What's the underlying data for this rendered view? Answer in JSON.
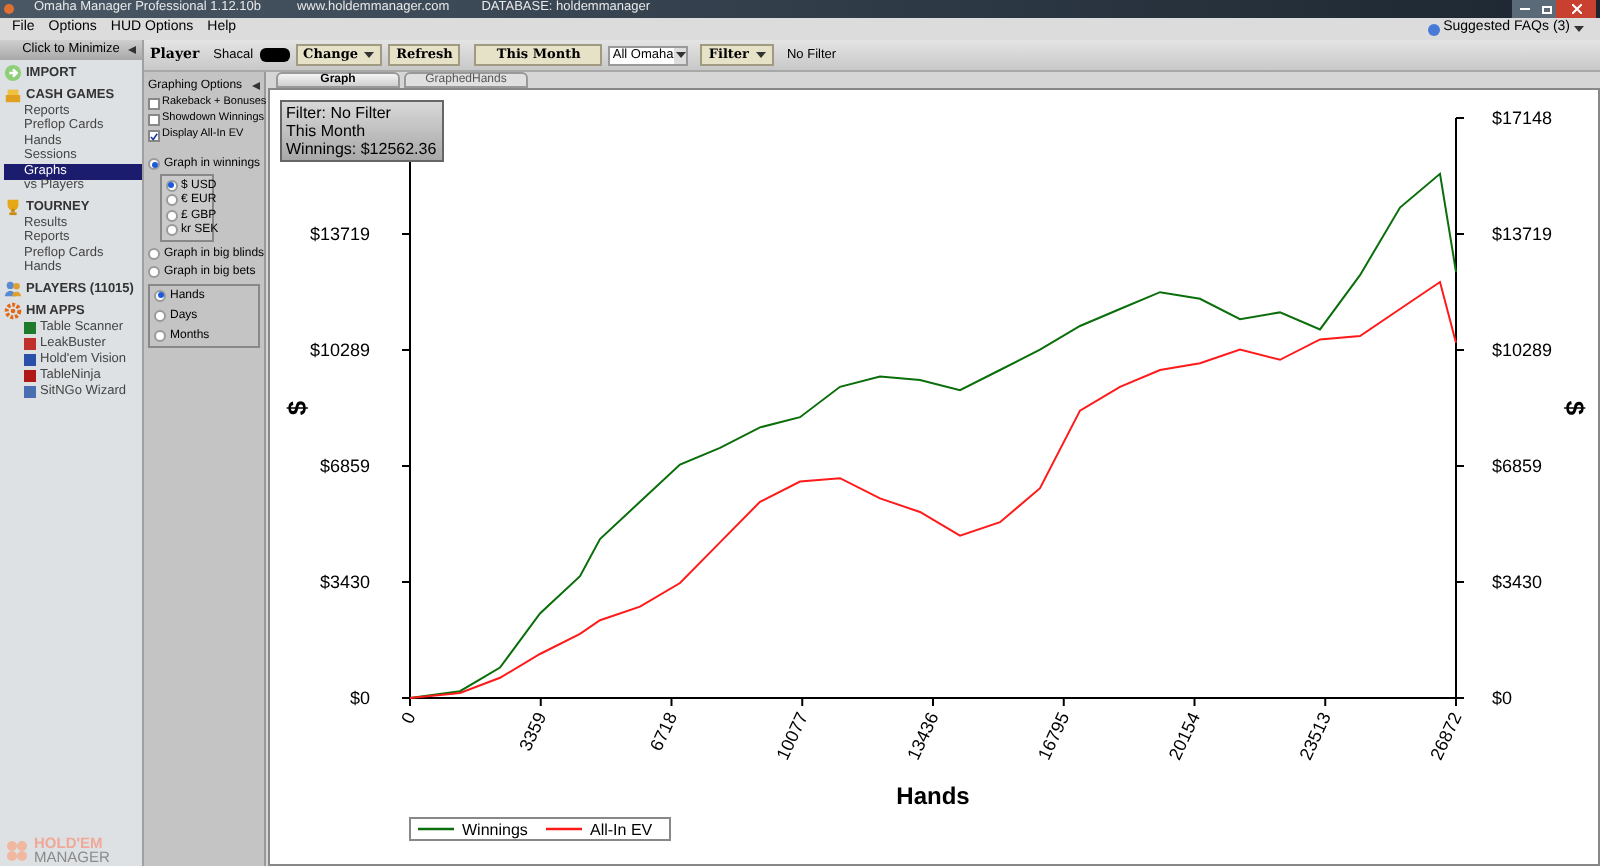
{
  "window": {
    "title": "Omaha Manager Professional 1.12.10b",
    "website": "www.holdemmanager.com",
    "database": "DATABASE: holdemmanager"
  },
  "menu": [
    "File",
    "Options",
    "HUD Options",
    "Help"
  ],
  "help_link": "Suggested FAQs (3)",
  "sidebar": {
    "minimize": "Click to Minimize",
    "sections": [
      {
        "kind": "import",
        "label": "IMPORT"
      },
      {
        "kind": "cash",
        "label": "CASH GAMES",
        "children": [
          {
            "label": "Reports",
            "selected": false
          },
          {
            "label": "Preflop Cards",
            "selected": false
          },
          {
            "label": "Hands",
            "selected": false
          },
          {
            "label": "Sessions",
            "selected": false
          },
          {
            "label": "Graphs",
            "selected": true
          },
          {
            "label": "vs Players",
            "selected": false
          }
        ]
      },
      {
        "kind": "tourney",
        "label": "TOURNEY",
        "children": [
          {
            "label": "Results",
            "selected": false
          },
          {
            "label": "Reports",
            "selected": false
          },
          {
            "label": "Preflop Cards",
            "selected": false
          },
          {
            "label": "Hands",
            "selected": false
          }
        ]
      },
      {
        "kind": "players",
        "label": "PLAYERS (11015)"
      },
      {
        "kind": "apps",
        "label": "HM APPS",
        "children": [
          {
            "label": "Table Scanner",
            "selected": false,
            "color": "#1f7a2a"
          },
          {
            "label": "LeakBuster",
            "selected": false,
            "color": "#c0302a"
          },
          {
            "label": "Hold'em Vision",
            "selected": false,
            "color": "#2a4fa8"
          },
          {
            "label": "TableNinja",
            "selected": false,
            "color": "#b01818"
          },
          {
            "label": "SitNGo Wizard",
            "selected": false,
            "color": "#4a6fb0"
          }
        ]
      }
    ],
    "logo": [
      "HOLD'EM",
      "MANAGER"
    ]
  },
  "toolbar": {
    "player_label": "Player",
    "player_name": "Shacal",
    "change": "Change",
    "refresh": "Refresh",
    "period": "This Month",
    "game": "All Omaha",
    "filter": "Filter",
    "filter_value": "No Filter"
  },
  "options": {
    "title": "Graphing Options",
    "checkboxes": [
      {
        "label": "Rakeback + Bonuses",
        "checked": false
      },
      {
        "label": "Showdown Winnings",
        "checked": false
      },
      {
        "label": "Display All-In EV",
        "checked": true
      }
    ],
    "graph_modes": [
      {
        "label": "Graph in winnings",
        "selected": true,
        "currencies": [
          {
            "label": "$ USD",
            "selected": true
          },
          {
            "label": "€ EUR",
            "selected": false
          },
          {
            "label": "£ GBP",
            "selected": false
          },
          {
            "label": "kr SEK",
            "selected": false
          }
        ]
      },
      {
        "label": "Graph in big blinds",
        "selected": false
      },
      {
        "label": "Graph in big bets",
        "selected": false
      }
    ],
    "legend_x": [
      {
        "label": "Hands",
        "selected": true
      },
      {
        "label": "Days",
        "selected": false
      },
      {
        "label": "Months",
        "selected": false
      }
    ]
  },
  "tabs": [
    {
      "label": "Graph",
      "selected": true
    },
    {
      "label": "GraphedHands",
      "selected": false
    }
  ],
  "graph": {
    "filter_box": [
      "Filter: No Filter",
      "This Month",
      "Winnings: $12562.36"
    ],
    "chart_data": {
      "type": "line",
      "xlabel": "Hands",
      "ylabel": "$",
      "x": [
        0,
        1285,
        2313,
        3340,
        4368,
        4882,
        5910,
        6937,
        7965,
        8993,
        10020,
        11048,
        12076,
        13103,
        14131,
        15159,
        16186,
        17214,
        18242,
        19269,
        20297,
        21325,
        22352,
        23380,
        24408,
        25435,
        26463,
        26872
      ],
      "series": [
        {
          "name": "Winnings",
          "color": "#0a6e0a",
          "values": [
            0,
            200,
            900,
            2500,
            3600,
            4700,
            5800,
            6900,
            7400,
            8000,
            8300,
            9200,
            9500,
            9400,
            9100,
            9700,
            10300,
            11000,
            11500,
            12000,
            11800,
            11200,
            11400,
            10900,
            12500,
            14500,
            15500,
            12600
          ]
        },
        {
          "name": "All-In EV",
          "color": "#ff1a1a",
          "values": [
            0,
            150,
            600,
            1300,
            1900,
            2300,
            2700,
            3400,
            4600,
            5800,
            6400,
            6500,
            5900,
            5500,
            4800,
            5200,
            6200,
            8500,
            9200,
            9700,
            9900,
            10300,
            10000,
            10600,
            10700,
            11500,
            12300,
            10500
          ]
        }
      ],
      "legend": "bottom-left",
      "xlim": [
        0,
        26872
      ],
      "ylim": [
        0,
        17148
      ],
      "xticks": [
        0,
        3359,
        6718,
        10077,
        13436,
        16795,
        20154,
        23513,
        26872
      ],
      "yticks": [
        {
          "value": 0,
          "label": "$0"
        },
        {
          "value": 3430,
          "label": "$3430"
        },
        {
          "value": 6859,
          "label": "$6859"
        },
        {
          "value": 10289,
          "label": "$10289"
        },
        {
          "value": 13719,
          "label": "$13719"
        },
        {
          "value": 17148,
          "label": "$17148"
        }
      ]
    }
  }
}
